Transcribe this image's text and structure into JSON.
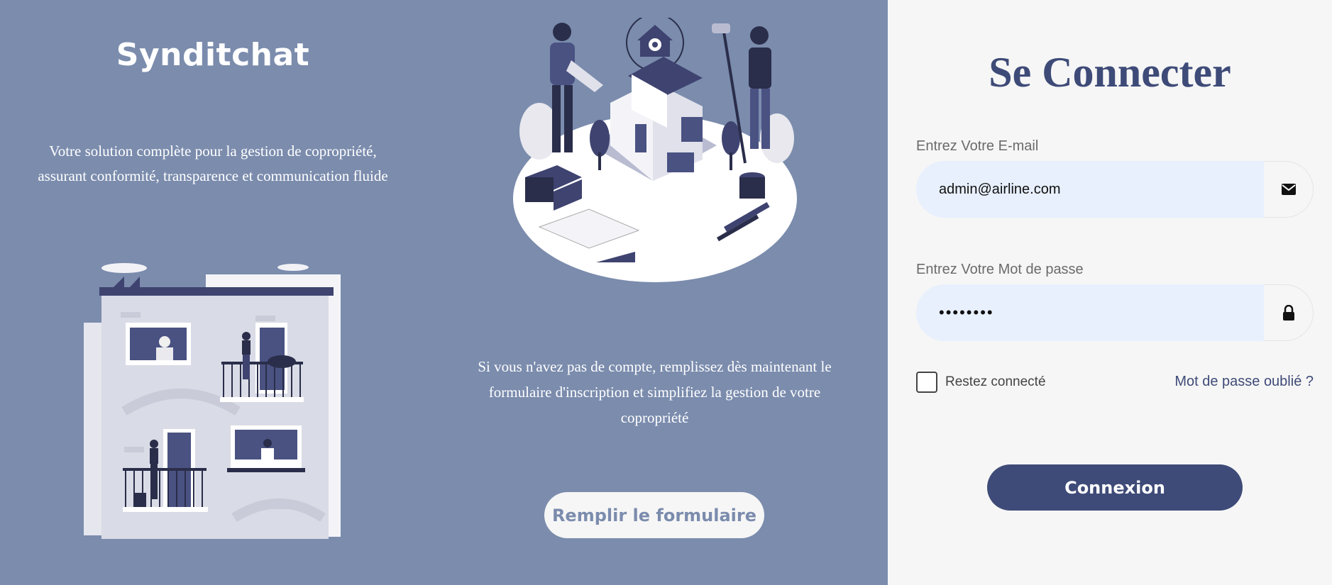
{
  "brand": {
    "title": "Synditchat",
    "tagline_line1": "Votre solution complète pour la gestion de copropriété,",
    "tagline_line2": "assurant conformité, transparence et communication fluide"
  },
  "signup": {
    "text_line1": "Si vous n'avez pas de compte, remplissez dès maintenant le",
    "text_line2": "formulaire d'inscription et simplifiez la gestion de votre",
    "text_line3": "copropriété",
    "button_label": "Remplir le formulaire"
  },
  "login": {
    "title": "Se Connecter",
    "email_label": "Entrez Votre E-mail",
    "email_value": "admin@airline.com",
    "password_label": "Entrez Votre Mot de passe",
    "password_value": "password",
    "remember_label": "Restez connecté",
    "forgot_label": "Mot de passe oublié ?",
    "submit_label": "Connexion"
  },
  "icons": {
    "email": "envelope-icon",
    "password": "lock-icon"
  },
  "colors": {
    "left_panel": "#7b8cad",
    "right_panel": "#f6f6f6",
    "accent": "#3e4b78",
    "input_bg": "#e8f0fd"
  }
}
